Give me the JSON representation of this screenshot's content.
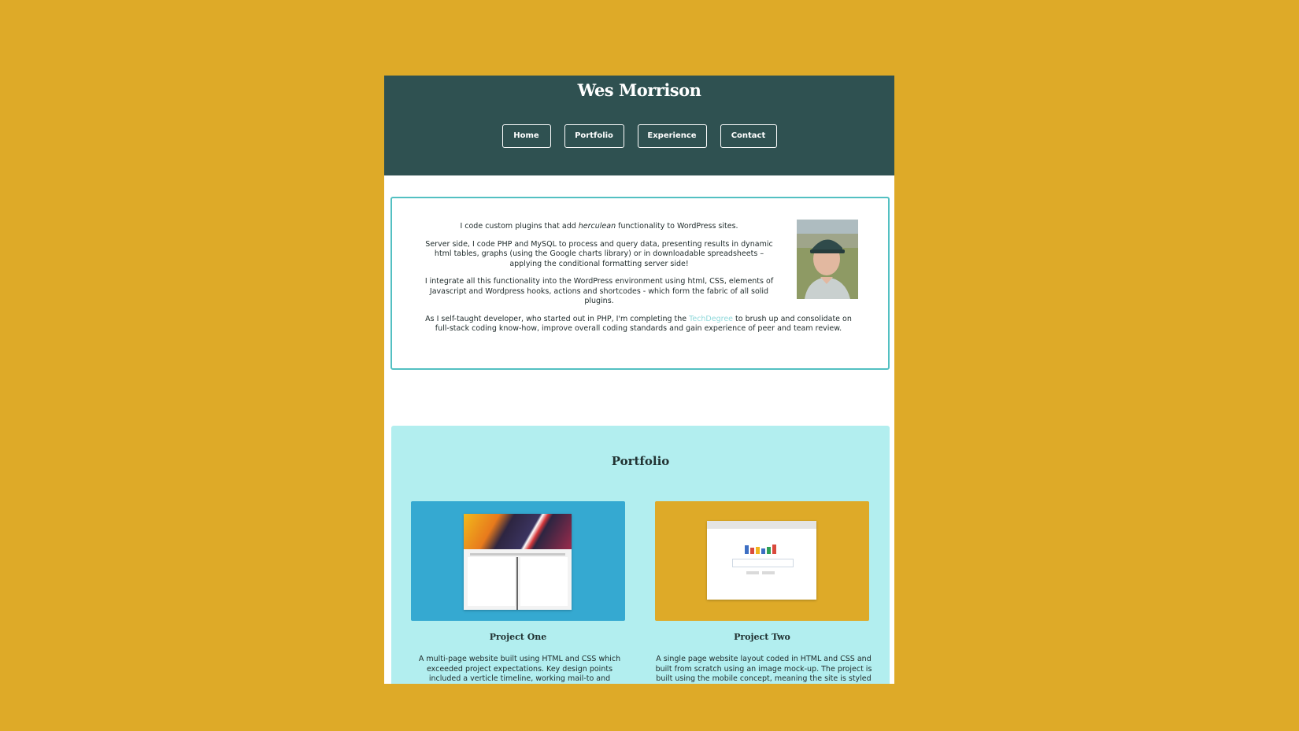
{
  "header": {
    "title": "Wes Morrison",
    "nav": [
      {
        "label": "Home"
      },
      {
        "label": "Portfolio"
      },
      {
        "label": "Experience"
      },
      {
        "label": "Contact"
      }
    ]
  },
  "about": {
    "p1_before": "I code custom plugins that add ",
    "p1_em": "herculean",
    "p1_after": " functionality to WordPress sites.",
    "p2": "Server side, I code PHP and MySQL to process and query data, presenting results in dynamic html tables, graphs (using the Google charts library) or in downloadable spreadsheets – applying the conditional formatting server side!",
    "p3": "I integrate all this functionality into the WordPress environment using html, CSS, elements of Javascript and Wordpress hooks, actions and shortcodes - which form the fabric of all solid plugins.",
    "p4_before": "As I self-taught developer, who started out in PHP, I'm completing the ",
    "p4_link": "TechDegree",
    "p4_after": " to brush up and consolidate on full-stack coding know-how, improve overall coding standards and gain experience of peer and team review."
  },
  "portfolio": {
    "heading": "Portfolio",
    "projects": [
      {
        "title": "Project One",
        "description": "A multi-page website built using HTML and CSS which exceeded project expectations. Key design points included a verticle timeline, working mail-to and hyperlinks and CSS"
      },
      {
        "title": "Project Two",
        "description": "A single page website layout coded in HTML and CSS and built from scratch using an image mock-up. The project is built using the mobile concept, meaning the site is styled"
      }
    ]
  },
  "colors": {
    "background": "#deaa28",
    "header": "#2f5151",
    "accent_border": "#53c0c2",
    "portfolio_bg": "#b2eeef",
    "link": "#8fd8da",
    "thumb_one": "#35a9d1",
    "thumb_two": "#deaa28"
  }
}
